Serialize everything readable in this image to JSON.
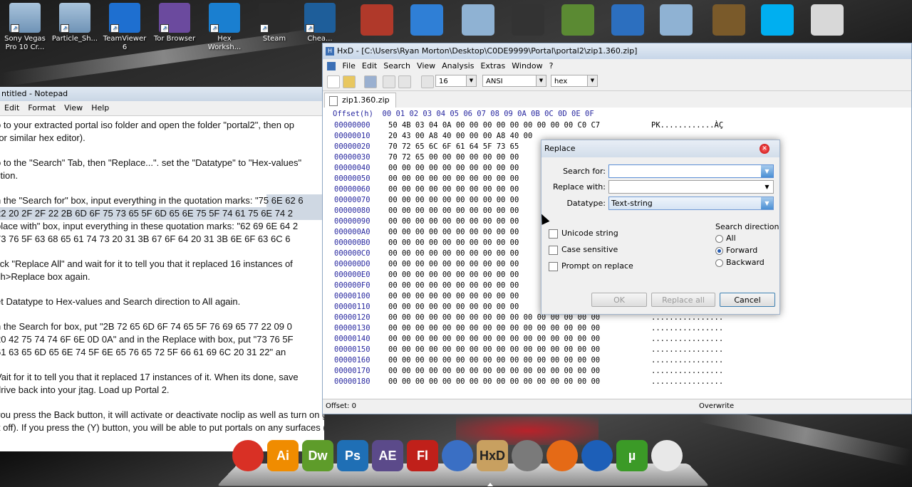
{
  "desktop": {
    "icons": [
      {
        "label": "Sony Vegas Pro 10 Cr...",
        "icon": "folder-icon",
        "color": "#8fb2d3"
      },
      {
        "label": "Particle_Sh...",
        "icon": "folder-icon",
        "color": "#8fb2d3"
      },
      {
        "label": "TeamViewer 6",
        "icon": "teamviewer-icon",
        "color": "#1e6fd0"
      },
      {
        "label": "Tor Browser",
        "icon": "tor-browser-icon",
        "color": "#6b4a9e"
      },
      {
        "label": "Hex Worksh...",
        "icon": "hex-workshop-icon",
        "color": "#1a7fd0"
      },
      {
        "label": "Steam",
        "icon": "steam-icon",
        "color": "#2a2a2a"
      },
      {
        "label": "Chea...",
        "icon": "cheat-engine-icon",
        "color": "#1e5e9a"
      }
    ],
    "top_icons": [
      {
        "icon": "tv-icon",
        "color": "#b0392a"
      },
      {
        "icon": "browser-globe-icon",
        "color": "#2f7fd6"
      },
      {
        "icon": "folder-icon",
        "color": "#8fb2d3"
      },
      {
        "icon": "chip-icon",
        "color": "#333333"
      },
      {
        "icon": "minecraft-icon",
        "color": "#5b8a33"
      },
      {
        "icon": "pen-icon",
        "color": "#2c6fbf"
      },
      {
        "icon": "folder-icon",
        "color": "#8fb2d3"
      },
      {
        "icon": "game-character-icon",
        "color": "#7a5a2a"
      },
      {
        "icon": "skype-icon",
        "color": "#00aff0"
      },
      {
        "icon": "printer-icon",
        "color": "#d8d8d8"
      }
    ]
  },
  "notepad": {
    "title": "ntitled - Notepad",
    "menu": [
      "Edit",
      "Format",
      "View",
      "Help"
    ],
    "lines": [
      "o to your extracted portal iso folder and open the folder \"portal2\", then op",
      "(or similar hex editor).",
      "",
      "o to the \"Search\" Tab, then \"Replace...\". set the \"Datatype\" to \"Hex-values\"",
      "ction.",
      "",
      "n the \"Search for\" box, input everything in the quotation marks: \"75 6E 62 6",
      "22 20 2F 2F 22 2B 6D 6F 75 73 65 5F 6D 65 6E 75 5F 74 61 75 6E 74 2",
      "place with\" box, input everything in these quotation marks: \"62 69 6E 64 2",
      "73 76 5F 63 68 65 61 74 73 20 31 3B 67 6F 64 20 31 3B 6E 6F 63 6C 6",
      "",
      "lick \"Replace All\" and wait for it to tell you that it replaced 16 instances of",
      "ch>Replace box again.",
      "",
      "et Datatype to Hex-values and Search direction to All again.",
      "",
      "n the Search for box, put \"2B 72 65 6D 6F 74 65 5F 76 69 65 77 22 09 0",
      "20 42 75 74 74 6F 6E 0D 0A\" and in the Replace with box, put \"73 76 5F",
      "61 63 65 6D 65 6E 74 5F 6E 65 76 65 72 5F 66 61 69 6C 20 31 22\" an",
      "",
      "Vait for it to tell you that it replaced 17 instances of it. When its done, save",
      "drive back into your jtag. Load up Portal 2.",
      "",
      "you press the Back button, it will activate or deactivate noclip as well as turn on god mode (you cant",
      "it off). If you press the (Y) button, you will be able to put portals on any surfaces (cant turn this off)."
    ]
  },
  "hxd": {
    "title": "HxD - [C:\\Users\\Ryan Morton\\Desktop\\C0DE9999\\Portal\\portal2\\zip1.360.zip]",
    "menu": [
      "File",
      "Edit",
      "Search",
      "View",
      "Analysis",
      "Extras",
      "Window",
      "?"
    ],
    "toolbar": {
      "bytes_per_row": "16",
      "charset": "ANSI",
      "offset_base": "hex"
    },
    "tab": "zip1.360.zip",
    "header": "Offset(h)  00 01 02 03 04 05 06 07 08 09 0A 0B 0C 0D 0E 0F",
    "rows": [
      {
        "off": "00000000",
        "bytes": "50 4B 03 04 0A 00 00 00 00 00 00 00 00 00 C0 C7",
        "asc": "PK............ÀÇ"
      },
      {
        "off": "00000010",
        "bytes": "20 43 00 A8 40 00 00 00 A8 40 00",
        "asc": ""
      },
      {
        "off": "00000020",
        "bytes": "70 72 65 6C 6F 61 64 5F 73 65",
        "asc": ""
      },
      {
        "off": "00000030",
        "bytes": "70 72 65 00 00 00 00 00 00 00",
        "asc": ""
      },
      {
        "off": "00000040",
        "bytes": "00 00 00 00 00 00 00 00 00 00",
        "asc": ""
      },
      {
        "off": "00000050",
        "bytes": "00 00 00 00 00 00 00 00 00 00",
        "asc": ""
      },
      {
        "off": "00000060",
        "bytes": "00 00 00 00 00 00 00 00 00 00",
        "asc": ""
      },
      {
        "off": "00000070",
        "bytes": "00 00 00 00 00 00 00 00 00 00",
        "asc": ""
      },
      {
        "off": "00000080",
        "bytes": "00 00 00 00 00 00 00 00 00 00",
        "asc": ""
      },
      {
        "off": "00000090",
        "bytes": "00 00 00 00 00 00 00 00 00 00",
        "asc": ""
      },
      {
        "off": "000000A0",
        "bytes": "00 00 00 00 00 00 00 00 00 00",
        "asc": ""
      },
      {
        "off": "000000B0",
        "bytes": "00 00 00 00 00 00 00 00 00 00",
        "asc": ""
      },
      {
        "off": "000000C0",
        "bytes": "00 00 00 00 00 00 00 00 00 00",
        "asc": ""
      },
      {
        "off": "000000D0",
        "bytes": "00 00 00 00 00 00 00 00 00 00",
        "asc": ""
      },
      {
        "off": "000000E0",
        "bytes": "00 00 00 00 00 00 00 00 00 00",
        "asc": ""
      },
      {
        "off": "000000F0",
        "bytes": "00 00 00 00 00 00 00 00 00 00",
        "asc": ""
      },
      {
        "off": "00000100",
        "bytes": "00 00 00 00 00 00 00 00 00 00",
        "asc": ""
      },
      {
        "off": "00000110",
        "bytes": "00 00 00 00 00 00 00 00 00 00",
        "asc": ""
      },
      {
        "off": "00000120",
        "bytes": "00 00 00 00 00 00 00 00 00 00 00 00 00 00 00 00",
        "asc": "................"
      },
      {
        "off": "00000130",
        "bytes": "00 00 00 00 00 00 00 00 00 00 00 00 00 00 00 00",
        "asc": "................"
      },
      {
        "off": "00000140",
        "bytes": "00 00 00 00 00 00 00 00 00 00 00 00 00 00 00 00",
        "asc": "................"
      },
      {
        "off": "00000150",
        "bytes": "00 00 00 00 00 00 00 00 00 00 00 00 00 00 00 00",
        "asc": "................"
      },
      {
        "off": "00000160",
        "bytes": "00 00 00 00 00 00 00 00 00 00 00 00 00 00 00 00",
        "asc": "................"
      },
      {
        "off": "00000170",
        "bytes": "00 00 00 00 00 00 00 00 00 00 00 00 00 00 00 00",
        "asc": "................"
      },
      {
        "off": "00000180",
        "bytes": "00 00 00 00 00 00 00 00 00 00 00 00 00 00 00 00",
        "asc": "................"
      }
    ],
    "status_offset": "Offset: 0",
    "status_mode": "Overwrite"
  },
  "replace": {
    "title": "Replace",
    "search_label": "Search for:",
    "search_value": "",
    "replace_label": "Replace with:",
    "replace_value": "",
    "datatype_label": "Datatype:",
    "datatype_value": "Text-string",
    "checks": [
      "Unicode string",
      "Case sensitive",
      "Prompt on replace"
    ],
    "direction_label": "Search direction",
    "directions": [
      "All",
      "Forward",
      "Backward"
    ],
    "direction_selected": "Forward",
    "ok": "OK",
    "replace_all": "Replace all",
    "cancel": "Cancel"
  },
  "dock": {
    "apps": [
      {
        "label": "",
        "icon": "chrome-icon",
        "color": "#d93025"
      },
      {
        "label": "Ai",
        "icon": "illustrator-icon",
        "color": "#f08c00"
      },
      {
        "label": "Dw",
        "icon": "dreamweaver-icon",
        "color": "#5e9c2a"
      },
      {
        "label": "Ps",
        "icon": "photoshop-icon",
        "color": "#1f6fb5"
      },
      {
        "label": "AE",
        "icon": "after-effects-icon",
        "color": "#5b4a8a"
      },
      {
        "label": "Fl",
        "icon": "flash-icon",
        "color": "#c0201a"
      },
      {
        "label": "",
        "icon": "help-icon",
        "color": "#3a6fc4"
      },
      {
        "label": "HxD",
        "icon": "hxd-icon",
        "color": "#c8a060"
      },
      {
        "label": "",
        "icon": "steam-dock-icon",
        "color": "#7a7a7a"
      },
      {
        "label": "",
        "icon": "firefox-icon",
        "color": "#e56a16"
      },
      {
        "label": "",
        "icon": "globe-icon",
        "color": "#1d5fb8"
      },
      {
        "label": "µ",
        "icon": "utorrent-icon",
        "color": "#3b9a27"
      },
      {
        "label": "",
        "icon": "clock-icon",
        "color": "#e8e8e8"
      }
    ]
  }
}
